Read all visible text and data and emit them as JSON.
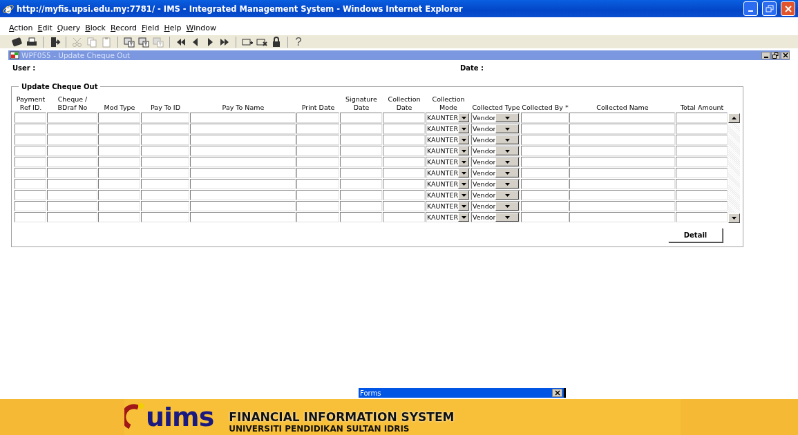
{
  "window": {
    "title": "http://myfis.upsi.edu.my:7781/ - IMS - Integrated Management System - Windows Internet Explorer"
  },
  "menu": [
    "Action",
    "Edit",
    "Query",
    "Block",
    "Record",
    "Field",
    "Help",
    "Window"
  ],
  "toolbar": [
    {
      "kind": "save",
      "disabled": false
    },
    {
      "kind": "print",
      "disabled": false
    },
    {
      "kind": "sep"
    },
    {
      "kind": "exit",
      "disabled": false
    },
    {
      "kind": "sep"
    },
    {
      "kind": "cut",
      "disabled": true
    },
    {
      "kind": "copy",
      "disabled": true
    },
    {
      "kind": "paste",
      "disabled": true
    },
    {
      "kind": "sep"
    },
    {
      "kind": "query-enter",
      "disabled": false
    },
    {
      "kind": "query-execute",
      "disabled": false
    },
    {
      "kind": "query-cancel",
      "disabled": true
    },
    {
      "kind": "sep"
    },
    {
      "kind": "first",
      "disabled": false
    },
    {
      "kind": "prev",
      "disabled": false
    },
    {
      "kind": "next",
      "disabled": false
    },
    {
      "kind": "last",
      "disabled": false
    },
    {
      "kind": "sep"
    },
    {
      "kind": "insert",
      "disabled": false
    },
    {
      "kind": "delete",
      "disabled": false
    },
    {
      "kind": "lock",
      "disabled": false
    },
    {
      "kind": "sep"
    },
    {
      "kind": "help",
      "text": "?",
      "disabled": false
    }
  ],
  "form": {
    "title": "WPF055 - Update Cheque Out",
    "user_label": "User :",
    "date_label": "Date :",
    "group_title": "Update Cheque Out",
    "columns": [
      {
        "label": "Payment\nRef ID.",
        "kind": "text"
      },
      {
        "label": "Cheque /\nBDraf No",
        "kind": "text"
      },
      {
        "label": "Mod Type",
        "kind": "text"
      },
      {
        "label": "Pay To ID",
        "kind": "text"
      },
      {
        "label": "Pay To Name",
        "kind": "text"
      },
      {
        "label": "Print Date",
        "kind": "text"
      },
      {
        "label": "Signature\nDate",
        "kind": "text"
      },
      {
        "label": "Collection\nDate",
        "kind": "text"
      },
      {
        "label": "Collection\nMode",
        "kind": "select"
      },
      {
        "label": "Collected Type",
        "kind": "select"
      },
      {
        "label": "Collected By *",
        "kind": "text"
      },
      {
        "label": "Collected Name",
        "kind": "text"
      },
      {
        "label": "Total Amount",
        "kind": "text"
      }
    ],
    "rows": [
      {
        "collection_mode": "KAUNTER",
        "collected_type": "Vendor"
      },
      {
        "collection_mode": "KAUNTER",
        "collected_type": "Vendor"
      },
      {
        "collection_mode": "KAUNTER",
        "collected_type": "Vendor"
      },
      {
        "collection_mode": "KAUNTER",
        "collected_type": "Vendor"
      },
      {
        "collection_mode": "KAUNTER",
        "collected_type": "Vendor"
      },
      {
        "collection_mode": "KAUNTER",
        "collected_type": "Vendor"
      },
      {
        "collection_mode": "KAUNTER",
        "collected_type": "Vendor"
      },
      {
        "collection_mode": "KAUNTER",
        "collected_type": "Vendor"
      },
      {
        "collection_mode": "KAUNTER",
        "collected_type": "Vendor"
      },
      {
        "collection_mode": "KAUNTER",
        "collected_type": "Vendor"
      }
    ],
    "detail_button": "Detail"
  },
  "forms_bar": {
    "title": "Forms"
  },
  "banner": {
    "logo": "uims",
    "title": "FINANCIAL INFORMATION SYSTEM",
    "subtitle": "UNIVERSITI PENDIDIKAN SULTAN IDRIS"
  }
}
